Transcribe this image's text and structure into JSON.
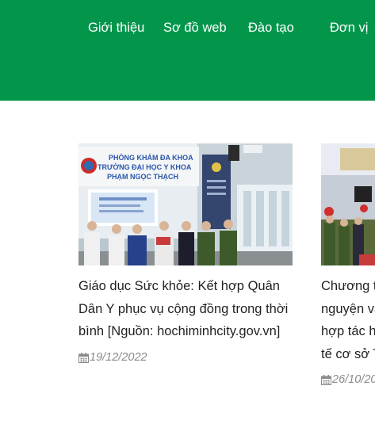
{
  "nav": {
    "items": [
      {
        "label": "Giới thiệu"
      },
      {
        "label": "Sơ đồ web"
      },
      {
        "label": "Đào tạo"
      },
      {
        "label": "Đơn vị"
      }
    ]
  },
  "colors": {
    "nav_background": "#03964b",
    "nav_text": "#ffffff",
    "title_text": "#222222",
    "date_text": "#8a8a8a"
  },
  "news": [
    {
      "title": "Giáo dục Sức khỏe: Kết hợp Quân Dân Y phục vụ cộng đồng trong thời bình [Nguồn: hochiminhcity.gov.vn]",
      "date": "19/12/2022",
      "image_sign": {
        "line1": "PHÒNG KHÁM ĐA KHOA",
        "line2": "TRƯỜNG ĐẠI HỌC Y KHOA",
        "line3": "PHẠM NGỌC THẠCH"
      },
      "icon": "calendar-icon"
    },
    {
      "title_lines": [
        "Chương tr",
        "nguyện và",
        "hợp tác hỗ",
        "tế cơ sở Tỉ"
      ],
      "date": "26/10/20",
      "icon": "calendar-icon"
    }
  ]
}
